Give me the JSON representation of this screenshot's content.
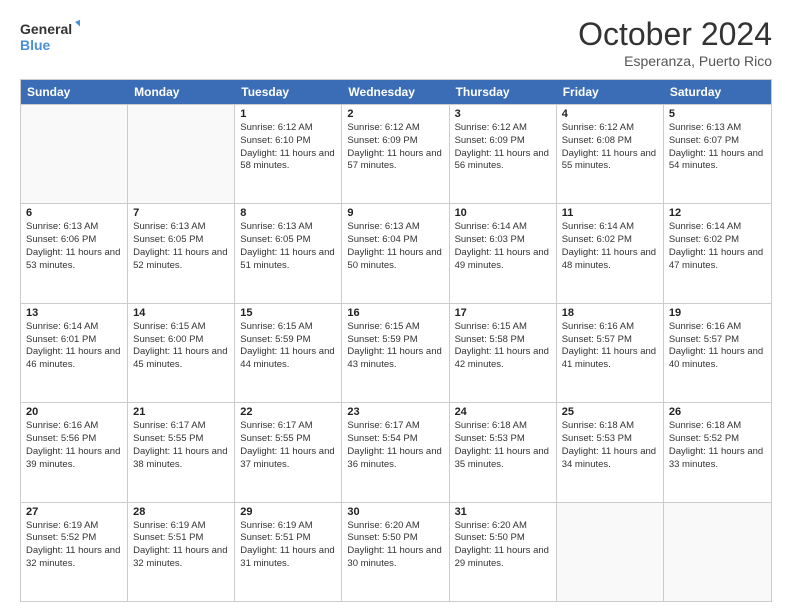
{
  "logo": {
    "line1": "General",
    "line2": "Blue"
  },
  "title": "October 2024",
  "subtitle": "Esperanza, Puerto Rico",
  "days_of_week": [
    "Sunday",
    "Monday",
    "Tuesday",
    "Wednesday",
    "Thursday",
    "Friday",
    "Saturday"
  ],
  "weeks": [
    [
      {
        "day": "",
        "sunrise": "",
        "sunset": "",
        "daylight": ""
      },
      {
        "day": "",
        "sunrise": "",
        "sunset": "",
        "daylight": ""
      },
      {
        "day": "1",
        "sunrise": "Sunrise: 6:12 AM",
        "sunset": "Sunset: 6:10 PM",
        "daylight": "Daylight: 11 hours and 58 minutes."
      },
      {
        "day": "2",
        "sunrise": "Sunrise: 6:12 AM",
        "sunset": "Sunset: 6:09 PM",
        "daylight": "Daylight: 11 hours and 57 minutes."
      },
      {
        "day": "3",
        "sunrise": "Sunrise: 6:12 AM",
        "sunset": "Sunset: 6:09 PM",
        "daylight": "Daylight: 11 hours and 56 minutes."
      },
      {
        "day": "4",
        "sunrise": "Sunrise: 6:12 AM",
        "sunset": "Sunset: 6:08 PM",
        "daylight": "Daylight: 11 hours and 55 minutes."
      },
      {
        "day": "5",
        "sunrise": "Sunrise: 6:13 AM",
        "sunset": "Sunset: 6:07 PM",
        "daylight": "Daylight: 11 hours and 54 minutes."
      }
    ],
    [
      {
        "day": "6",
        "sunrise": "Sunrise: 6:13 AM",
        "sunset": "Sunset: 6:06 PM",
        "daylight": "Daylight: 11 hours and 53 minutes."
      },
      {
        "day": "7",
        "sunrise": "Sunrise: 6:13 AM",
        "sunset": "Sunset: 6:05 PM",
        "daylight": "Daylight: 11 hours and 52 minutes."
      },
      {
        "day": "8",
        "sunrise": "Sunrise: 6:13 AM",
        "sunset": "Sunset: 6:05 PM",
        "daylight": "Daylight: 11 hours and 51 minutes."
      },
      {
        "day": "9",
        "sunrise": "Sunrise: 6:13 AM",
        "sunset": "Sunset: 6:04 PM",
        "daylight": "Daylight: 11 hours and 50 minutes."
      },
      {
        "day": "10",
        "sunrise": "Sunrise: 6:14 AM",
        "sunset": "Sunset: 6:03 PM",
        "daylight": "Daylight: 11 hours and 49 minutes."
      },
      {
        "day": "11",
        "sunrise": "Sunrise: 6:14 AM",
        "sunset": "Sunset: 6:02 PM",
        "daylight": "Daylight: 11 hours and 48 minutes."
      },
      {
        "day": "12",
        "sunrise": "Sunrise: 6:14 AM",
        "sunset": "Sunset: 6:02 PM",
        "daylight": "Daylight: 11 hours and 47 minutes."
      }
    ],
    [
      {
        "day": "13",
        "sunrise": "Sunrise: 6:14 AM",
        "sunset": "Sunset: 6:01 PM",
        "daylight": "Daylight: 11 hours and 46 minutes."
      },
      {
        "day": "14",
        "sunrise": "Sunrise: 6:15 AM",
        "sunset": "Sunset: 6:00 PM",
        "daylight": "Daylight: 11 hours and 45 minutes."
      },
      {
        "day": "15",
        "sunrise": "Sunrise: 6:15 AM",
        "sunset": "Sunset: 5:59 PM",
        "daylight": "Daylight: 11 hours and 44 minutes."
      },
      {
        "day": "16",
        "sunrise": "Sunrise: 6:15 AM",
        "sunset": "Sunset: 5:59 PM",
        "daylight": "Daylight: 11 hours and 43 minutes."
      },
      {
        "day": "17",
        "sunrise": "Sunrise: 6:15 AM",
        "sunset": "Sunset: 5:58 PM",
        "daylight": "Daylight: 11 hours and 42 minutes."
      },
      {
        "day": "18",
        "sunrise": "Sunrise: 6:16 AM",
        "sunset": "Sunset: 5:57 PM",
        "daylight": "Daylight: 11 hours and 41 minutes."
      },
      {
        "day": "19",
        "sunrise": "Sunrise: 6:16 AM",
        "sunset": "Sunset: 5:57 PM",
        "daylight": "Daylight: 11 hours and 40 minutes."
      }
    ],
    [
      {
        "day": "20",
        "sunrise": "Sunrise: 6:16 AM",
        "sunset": "Sunset: 5:56 PM",
        "daylight": "Daylight: 11 hours and 39 minutes."
      },
      {
        "day": "21",
        "sunrise": "Sunrise: 6:17 AM",
        "sunset": "Sunset: 5:55 PM",
        "daylight": "Daylight: 11 hours and 38 minutes."
      },
      {
        "day": "22",
        "sunrise": "Sunrise: 6:17 AM",
        "sunset": "Sunset: 5:55 PM",
        "daylight": "Daylight: 11 hours and 37 minutes."
      },
      {
        "day": "23",
        "sunrise": "Sunrise: 6:17 AM",
        "sunset": "Sunset: 5:54 PM",
        "daylight": "Daylight: 11 hours and 36 minutes."
      },
      {
        "day": "24",
        "sunrise": "Sunrise: 6:18 AM",
        "sunset": "Sunset: 5:53 PM",
        "daylight": "Daylight: 11 hours and 35 minutes."
      },
      {
        "day": "25",
        "sunrise": "Sunrise: 6:18 AM",
        "sunset": "Sunset: 5:53 PM",
        "daylight": "Daylight: 11 hours and 34 minutes."
      },
      {
        "day": "26",
        "sunrise": "Sunrise: 6:18 AM",
        "sunset": "Sunset: 5:52 PM",
        "daylight": "Daylight: 11 hours and 33 minutes."
      }
    ],
    [
      {
        "day": "27",
        "sunrise": "Sunrise: 6:19 AM",
        "sunset": "Sunset: 5:52 PM",
        "daylight": "Daylight: 11 hours and 32 minutes."
      },
      {
        "day": "28",
        "sunrise": "Sunrise: 6:19 AM",
        "sunset": "Sunset: 5:51 PM",
        "daylight": "Daylight: 11 hours and 32 minutes."
      },
      {
        "day": "29",
        "sunrise": "Sunrise: 6:19 AM",
        "sunset": "Sunset: 5:51 PM",
        "daylight": "Daylight: 11 hours and 31 minutes."
      },
      {
        "day": "30",
        "sunrise": "Sunrise: 6:20 AM",
        "sunset": "Sunset: 5:50 PM",
        "daylight": "Daylight: 11 hours and 30 minutes."
      },
      {
        "day": "31",
        "sunrise": "Sunrise: 6:20 AM",
        "sunset": "Sunset: 5:50 PM",
        "daylight": "Daylight: 11 hours and 29 minutes."
      },
      {
        "day": "",
        "sunrise": "",
        "sunset": "",
        "daylight": ""
      },
      {
        "day": "",
        "sunrise": "",
        "sunset": "",
        "daylight": ""
      }
    ]
  ]
}
